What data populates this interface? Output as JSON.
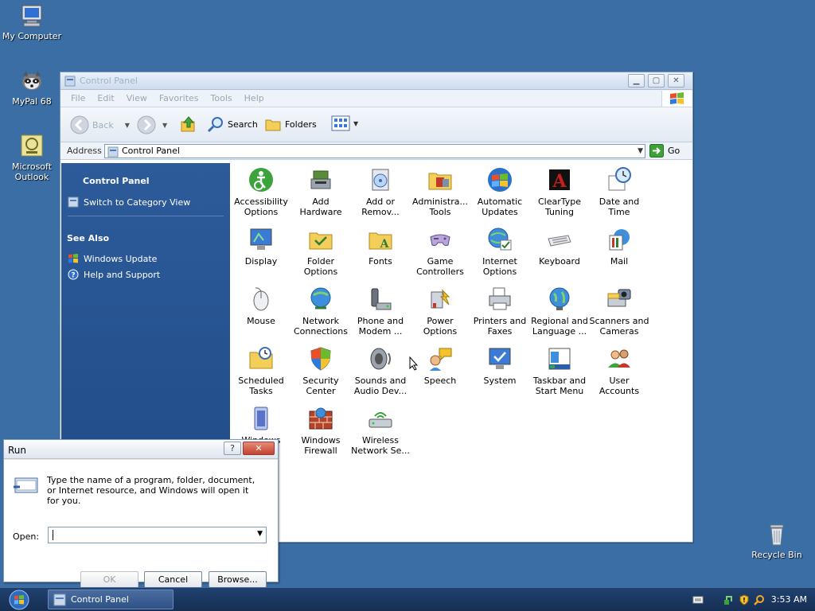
{
  "desktop": {
    "icons": [
      {
        "label": "My Computer",
        "icon": "computer-icon"
      },
      {
        "label": "MyPal 68",
        "icon": "raccoon-browser-icon"
      },
      {
        "label": "Microsoft Outlook",
        "icon": "outlook-icon"
      },
      {
        "label": "Recycle Bin",
        "icon": "recycle-bin-icon"
      }
    ]
  },
  "window": {
    "title": "Control Panel",
    "menu": [
      "File",
      "Edit",
      "View",
      "Favorites",
      "Tools",
      "Help"
    ],
    "toolbar": {
      "back": "Back",
      "search": "Search",
      "folders": "Folders"
    },
    "address": {
      "label": "Address",
      "value": "Control Panel",
      "go": "Go"
    },
    "taskpane": {
      "heading": "Control Panel",
      "switch_view": "Switch to Category View",
      "see_also": "See Also",
      "links": [
        "Windows Update",
        "Help and Support"
      ]
    },
    "items": [
      {
        "l1": "Accessibility",
        "l2": "Options",
        "icon": "accessibility-icon"
      },
      {
        "l1": "Add",
        "l2": "Hardware",
        "icon": "add-hardware-icon"
      },
      {
        "l1": "Add or",
        "l2": "Remov...",
        "icon": "add-remove-programs-icon"
      },
      {
        "l1": "Administra...",
        "l2": "Tools",
        "icon": "admin-tools-icon"
      },
      {
        "l1": "Automatic",
        "l2": "Updates",
        "icon": "windows-flag-icon"
      },
      {
        "l1": "ClearType",
        "l2": "Tuning",
        "icon": "cleartype-icon"
      },
      {
        "l1": "Date and",
        "l2": "Time",
        "icon": "clock-icon"
      },
      {
        "l1": "Display",
        "l2": "",
        "icon": "display-icon"
      },
      {
        "l1": "Folder",
        "l2": "Options",
        "icon": "folder-options-icon"
      },
      {
        "l1": "Fonts",
        "l2": "",
        "icon": "fonts-folder-icon"
      },
      {
        "l1": "Game",
        "l2": "Controllers",
        "icon": "gamepad-icon"
      },
      {
        "l1": "Internet",
        "l2": "Options",
        "icon": "internet-options-icon"
      },
      {
        "l1": "Keyboard",
        "l2": "",
        "icon": "keyboard-icon"
      },
      {
        "l1": "Mail",
        "l2": "",
        "icon": "mail-icon"
      },
      {
        "l1": "Mouse",
        "l2": "",
        "icon": "mouse-icon"
      },
      {
        "l1": "Network",
        "l2": "Connections",
        "icon": "network-icon"
      },
      {
        "l1": "Phone and",
        "l2": "Modem ...",
        "icon": "phone-modem-icon"
      },
      {
        "l1": "Power",
        "l2": "Options",
        "icon": "power-icon"
      },
      {
        "l1": "Printers and",
        "l2": "Faxes",
        "icon": "printer-icon"
      },
      {
        "l1": "Regional and",
        "l2": "Language ...",
        "icon": "globe-icon"
      },
      {
        "l1": "Scanners and",
        "l2": "Cameras",
        "icon": "scanner-icon"
      },
      {
        "l1": "Scheduled",
        "l2": "Tasks",
        "icon": "scheduled-tasks-icon"
      },
      {
        "l1": "Security",
        "l2": "Center",
        "icon": "security-shield-icon"
      },
      {
        "l1": "Sounds and",
        "l2": "Audio Dev...",
        "icon": "speaker-icon"
      },
      {
        "l1": "Speech",
        "l2": "",
        "icon": "speech-icon"
      },
      {
        "l1": "System",
        "l2": "",
        "icon": "system-icon"
      },
      {
        "l1": "Taskbar and",
        "l2": "Start Menu",
        "icon": "taskbar-icon"
      },
      {
        "l1": "User",
        "l2": "Accounts",
        "icon": "users-icon"
      },
      {
        "l1": "Windows",
        "l2": "",
        "icon": "windows-cardspace-icon"
      },
      {
        "l1": "Windows",
        "l2": "Firewall",
        "icon": "firewall-icon"
      },
      {
        "l1": "Wireless",
        "l2": "Network Se...",
        "icon": "wireless-icon"
      }
    ]
  },
  "run_dialog": {
    "title": "Run",
    "help": "?",
    "description": "Type the name of a program, folder, document, or Internet resource, and Windows will open it for you.",
    "open_label": "Open:",
    "open_value": "",
    "ok": "OK",
    "cancel": "Cancel",
    "browse": "Browse..."
  },
  "taskbar": {
    "task": "Control Panel",
    "clock": "3:53 AM"
  }
}
